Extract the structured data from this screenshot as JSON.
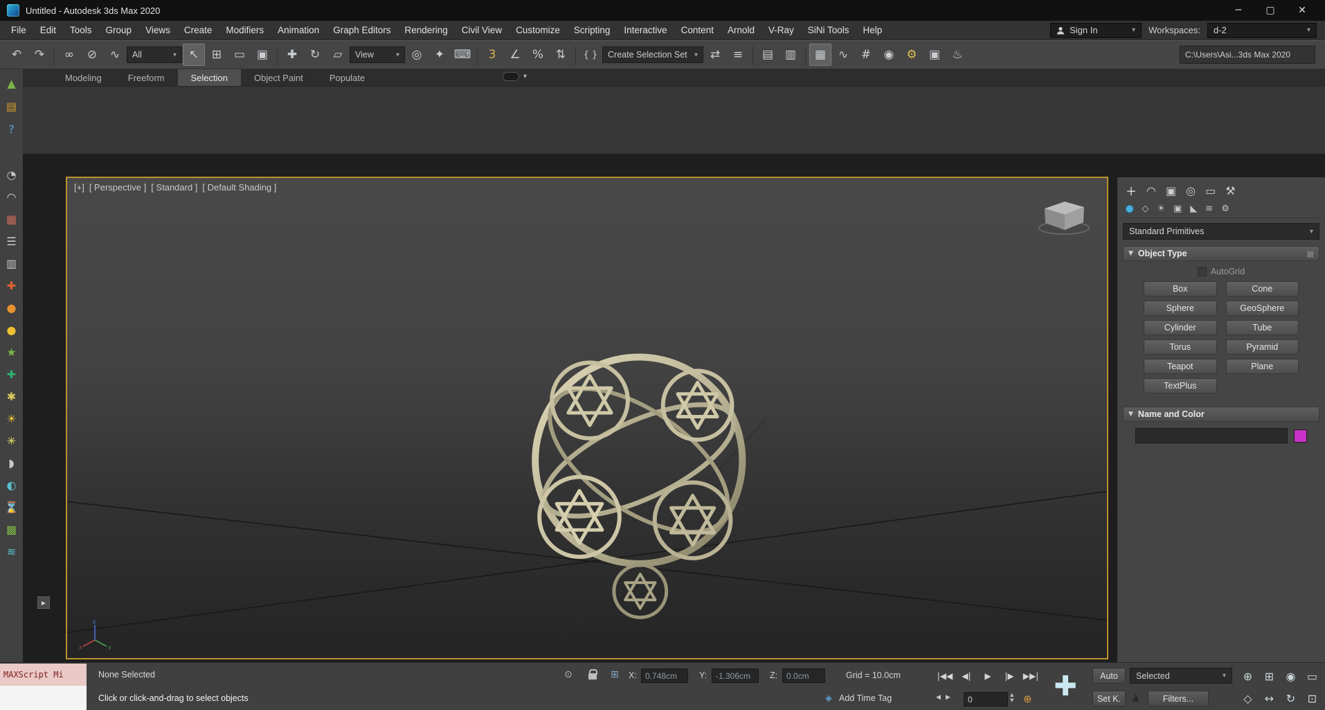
{
  "window": {
    "title": "Untitled - Autodesk 3ds Max 2020",
    "controls": [
      {
        "name": "minimize-button",
        "glyph": "─"
      },
      {
        "name": "maximize-button",
        "glyph": "▢"
      },
      {
        "name": "close-button",
        "glyph": "✕"
      }
    ]
  },
  "menubar": {
    "items": [
      "File",
      "Edit",
      "Tools",
      "Group",
      "Views",
      "Create",
      "Modifiers",
      "Animation",
      "Graph Editors",
      "Rendering",
      "Civil View",
      "Customize",
      "Scripting",
      "Interactive",
      "Content",
      "Arnold",
      "V-Ray",
      "SiNi Tools",
      "Help"
    ],
    "sign_in": "Sign In",
    "workspaces_label": "Workspaces:",
    "workspace_value": "d-2"
  },
  "toolbar": {
    "selection_filter": "All",
    "coord_system": "View",
    "selection_set": "Create Selection Set",
    "project_path": "C:\\Users\\Asi...3ds Max 2020",
    "group1": [
      {
        "name": "undo-icon",
        "glyph": "↶"
      },
      {
        "name": "redo-icon",
        "glyph": "↷"
      }
    ],
    "group2": [
      {
        "name": "select-and-link-icon",
        "glyph": "∞"
      },
      {
        "name": "unlink-selection-icon",
        "glyph": "⊘"
      },
      {
        "name": "bind-to-space-warp-icon",
        "glyph": "∿"
      }
    ],
    "group3": [
      {
        "name": "select-object-icon",
        "glyph": "↖",
        "active": true
      },
      {
        "name": "select-by-name-icon",
        "glyph": "⊞"
      },
      {
        "name": "rectangular-selection-region-icon",
        "glyph": "▭"
      },
      {
        "name": "window-crossing-icon",
        "glyph": "▣"
      }
    ],
    "group4": [
      {
        "name": "select-and-move-icon",
        "glyph": "✚"
      },
      {
        "name": "select-and-rotate-icon",
        "glyph": "↻"
      },
      {
        "name": "select-and-scale-icon",
        "glyph": "▱"
      }
    ],
    "group5": [
      {
        "name": "use-pivot-point-icon",
        "glyph": "◎"
      },
      {
        "name": "select-and-manipulate-icon",
        "glyph": "✦"
      },
      {
        "name": "keyboard-override-icon",
        "glyph": "⌨"
      }
    ],
    "group6": [
      {
        "name": "snaps-toggle-3d-icon",
        "glyph": "3",
        "color": "#d9b44a"
      },
      {
        "name": "angle-snap-icon",
        "glyph": "∠"
      },
      {
        "name": "percent-snap-icon",
        "glyph": "%"
      },
      {
        "name": "spinner-snap-icon",
        "glyph": "⇅"
      }
    ],
    "group7": [
      {
        "name": "edit-named-selection-sets-icon",
        "glyph": "{ }"
      }
    ],
    "group8": [
      {
        "name": "mirror-icon",
        "glyph": "⇄"
      },
      {
        "name": "align-icon",
        "glyph": "≡"
      }
    ],
    "group9": [
      {
        "name": "toggle-scene-explorer-icon",
        "glyph": "▤"
      },
      {
        "name": "toggle-layer-explorer-icon",
        "glyph": "▥"
      }
    ],
    "group10": [
      {
        "name": "toggle-ribbon-icon",
        "glyph": "▦",
        "active": true
      },
      {
        "name": "curve-editor-icon",
        "glyph": "∿"
      },
      {
        "name": "schematic-view-icon",
        "glyph": "#"
      },
      {
        "name": "material-editor-icon",
        "glyph": "◉"
      },
      {
        "name": "render-setup-icon",
        "glyph": "⚙",
        "color": "#d9c050"
      },
      {
        "name": "rendered-frame-window-icon",
        "glyph": "▣"
      },
      {
        "name": "render-production-icon",
        "glyph": "♨"
      }
    ]
  },
  "ribbon": {
    "tabs": [
      {
        "label": "Modeling",
        "active": false
      },
      {
        "label": "Freeform",
        "active": false
      },
      {
        "label": "Selection",
        "active": true
      },
      {
        "label": "Object Paint",
        "active": false
      },
      {
        "label": "Populate",
        "active": false
      }
    ]
  },
  "left_toolbar": {
    "top_icons": [
      {
        "name": "populate-tools-icon",
        "glyph": "▲",
        "color": "#7ab648"
      },
      {
        "name": "notes-icon",
        "glyph": "▤",
        "color": "#d99a2b"
      },
      {
        "name": "help-icon",
        "glyph": "?",
        "color": "#5aa7d9"
      }
    ],
    "tool_icons": [
      {
        "name": "clock-icon",
        "glyph": "◔",
        "color": "#c8c8c8"
      },
      {
        "name": "dome-icon",
        "glyph": "◠",
        "color": "#c8c8c8"
      },
      {
        "name": "record-icon",
        "glyph": "▦",
        "color": "#c86a5a"
      },
      {
        "name": "list-icon",
        "glyph": "☰",
        "color": "#c8c8c8"
      },
      {
        "name": "film-icon",
        "glyph": "▥",
        "color": "#c8c8c8"
      },
      {
        "name": "pin-orange-icon",
        "glyph": "✚",
        "color": "#e0622d"
      },
      {
        "name": "cylinder-orange-icon",
        "glyph": "●",
        "color": "#e8922f"
      },
      {
        "name": "sphere-yellow-icon",
        "glyph": "●",
        "color": "#f0c030"
      },
      {
        "name": "polygon-color-icon",
        "glyph": "★",
        "color": "#7ab648"
      },
      {
        "name": "pin-green-icon",
        "glyph": "✚",
        "color": "#2faf6e"
      },
      {
        "name": "flower-icon",
        "glyph": "✱",
        "color": "#d9c85a"
      },
      {
        "name": "sun-icon",
        "glyph": "☀",
        "color": "#f0c030"
      },
      {
        "name": "sparkle-icon",
        "glyph": "✳",
        "color": "#e8e06a"
      },
      {
        "name": "half-cylinder-icon",
        "glyph": "◗",
        "color": "#c8c8c8"
      },
      {
        "name": "sphere-blue-icon",
        "glyph": "◐",
        "color": "#5ac0d0"
      },
      {
        "name": "hourglass-icon",
        "glyph": "⌛",
        "color": "#5ac0d0"
      },
      {
        "name": "cube-colored-icon",
        "glyph": "▩",
        "color": "#7ab648"
      },
      {
        "name": "waves-icon",
        "glyph": "≋",
        "color": "#5ac0d0"
      }
    ]
  },
  "viewport": {
    "menu_items": [
      "[+]",
      "[ Perspective ]",
      "[ Standard ]",
      "[ Default Shading ]"
    ]
  },
  "command_panel": {
    "tabs": [
      {
        "name": "create-tab",
        "glyph": "＋",
        "active": true
      },
      {
        "name": "modify-tab",
        "glyph": "◠"
      },
      {
        "name": "hierarchy-tab",
        "glyph": "▣"
      },
      {
        "name": "motion-tab",
        "glyph": "◎"
      },
      {
        "name": "display-tab",
        "glyph": "▭"
      },
      {
        "name": "utilities-tab",
        "glyph": "⚒"
      }
    ],
    "subtabs": [
      {
        "name": "geometry-subtab",
        "glyph": "●",
        "active": true
      },
      {
        "name": "shapes-subtab",
        "glyph": "◇"
      },
      {
        "name": "lights-subtab",
        "glyph": "☀"
      },
      {
        "name": "cameras-subtab",
        "glyph": "▣"
      },
      {
        "name": "helpers-subtab",
        "glyph": "◣"
      },
      {
        "name": "space-warps-subtab",
        "glyph": "≋"
      },
      {
        "name": "systems-subtab",
        "glyph": "⚙"
      }
    ],
    "category": "Standard Primitives",
    "object_type": {
      "title": "Object Type",
      "autogrid": "AutoGrid",
      "buttons": [
        {
          "label": "Box",
          "name": "box-button"
        },
        {
          "label": "Cone",
          "name": "cone-button"
        },
        {
          "label": "Sphere",
          "name": "sphere-button"
        },
        {
          "label": "GeoSphere",
          "name": "geosphere-button"
        },
        {
          "label": "Cylinder",
          "name": "cylinder-button"
        },
        {
          "label": "Tube",
          "name": "tube-button"
        },
        {
          "label": "Torus",
          "name": "torus-button"
        },
        {
          "label": "Pyramid",
          "name": "pyramid-button"
        },
        {
          "label": "Teapot",
          "name": "teapot-button"
        },
        {
          "label": "Plane",
          "name": "plane-button"
        },
        {
          "label": "TextPlus",
          "name": "textplus-button"
        }
      ]
    },
    "name_color": {
      "title": "Name and Color",
      "value": "",
      "object_color": "#c832c8"
    }
  },
  "statusbar": {
    "maxscript": "MAXScript Mi",
    "status": "None Selected",
    "prompt": "Click or click-and-drag to select objects",
    "x_label": "X:",
    "x": "0.748cm",
    "y_label": "Y:",
    "y": "-1.306cm",
    "z_label": "Z:",
    "z": "0.0cm",
    "grid": "Grid = 10.0cm",
    "time_tag": "Add Time Tag",
    "frame": "0",
    "auto": "Auto",
    "selected": "Selected",
    "set_key": "Set K.",
    "filters": "Filters...",
    "playback": [
      {
        "name": "go-to-start-button",
        "glyph": "|◀◀"
      },
      {
        "name": "previous-frame-button",
        "glyph": "◀|"
      },
      {
        "name": "play-button",
        "glyph": "▶"
      },
      {
        "name": "next-frame-button",
        "glyph": "|▶"
      },
      {
        "name": "go-to-end-button",
        "glyph": "▶▶|"
      }
    ],
    "nav": [
      {
        "name": "zoom-icon",
        "glyph": "⊕"
      },
      {
        "name": "zoom-all-icon",
        "glyph": "⊞"
      },
      {
        "name": "zoom-extents-icon",
        "glyph": "◉"
      },
      {
        "name": "zoom-region-icon",
        "glyph": "▭"
      },
      {
        "name": "field-of-view-icon",
        "glyph": "◇"
      },
      {
        "name": "pan-icon",
        "glyph": "↔"
      },
      {
        "name": "orbit-icon",
        "glyph": "↻"
      },
      {
        "name": "maximize-viewport-icon",
        "glyph": "⊡"
      }
    ]
  }
}
